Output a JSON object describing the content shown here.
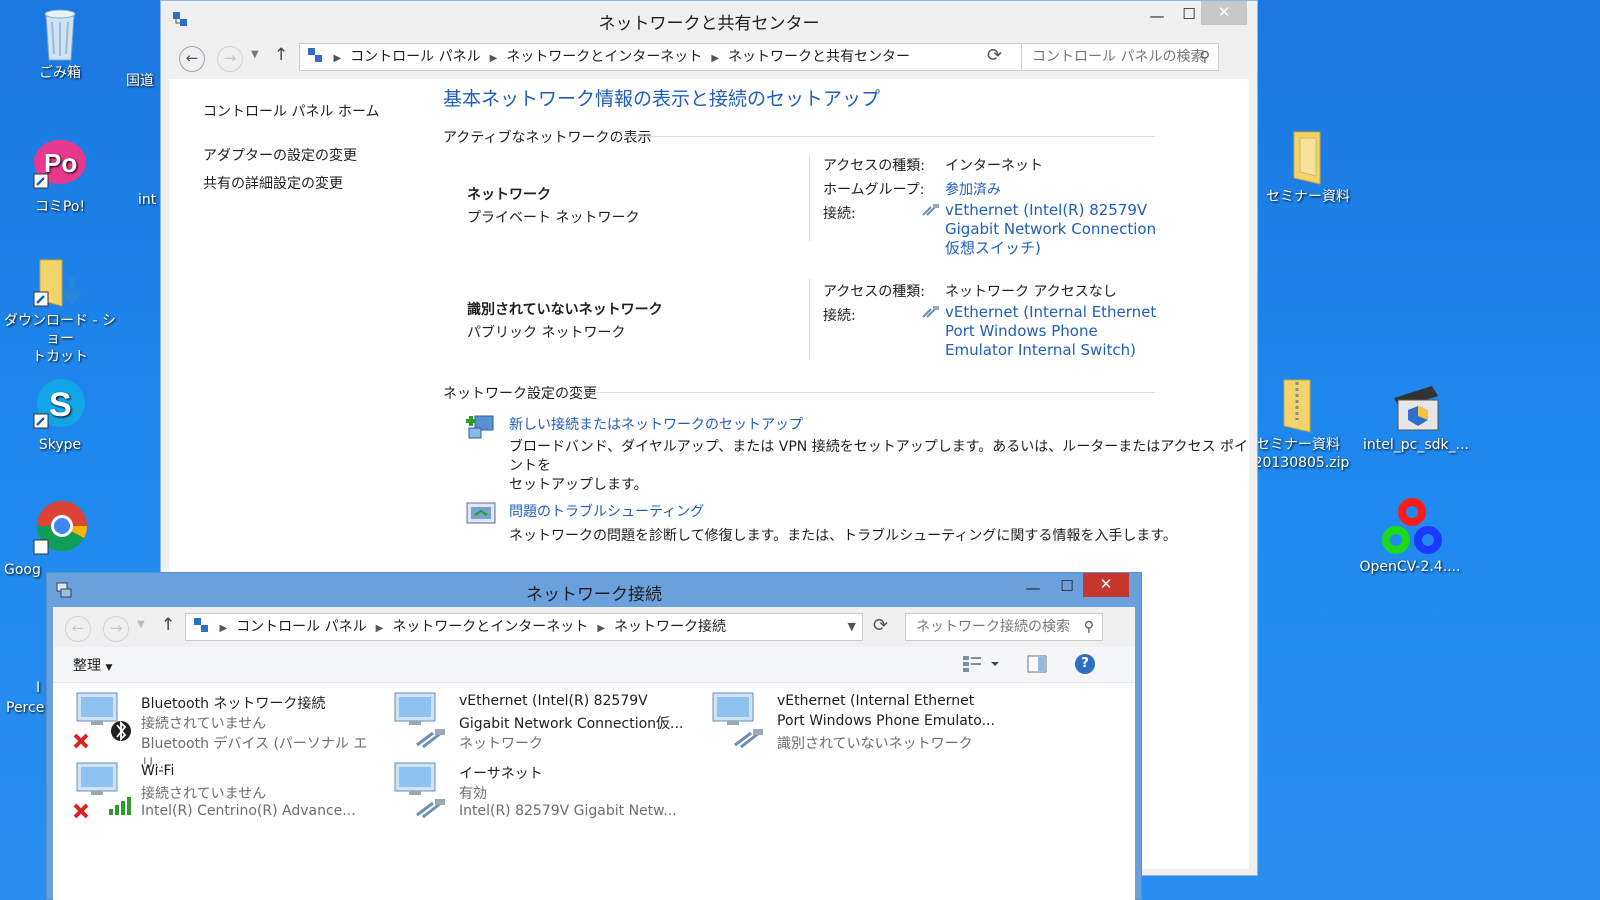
{
  "desktop": {
    "icons": [
      {
        "label": "ごみ箱"
      },
      {
        "label": "コミPo!"
      },
      {
        "label": "ダウンロード - ショートカット"
      },
      {
        "label": "Skype"
      },
      {
        "label": "Goog"
      },
      {
        "label": "セミナー資料"
      },
      {
        "label": "セミナー資料_20130805.zip"
      },
      {
        "label": "intel_pc_sdk_..."
      },
      {
        "label": "OpenCV-2.4...."
      }
    ],
    "partial": {
      "kokudo": "国道",
      "int": "int",
      "perce": "Perce",
      "i": "I"
    }
  },
  "nsc": {
    "title": "ネットワークと共有センター",
    "breadcrumbs": [
      "コントロール パネル",
      "ネットワークとインターネット",
      "ネットワークと共有センター"
    ],
    "search_placeholder": "コントロール パネルの検索",
    "sidebar": {
      "home": "コントロール パネル ホーム",
      "links": [
        "アダプターの設定の変更",
        "共有の詳細設定の変更"
      ]
    },
    "heading": "基本ネットワーク情報の表示と接続のセットアップ",
    "active_section": "アクティブなネットワークの表示",
    "networks": [
      {
        "name": "ネットワーク",
        "type": "プライベート ネットワーク",
        "access_label": "アクセスの種類:",
        "access_value": "インターネット",
        "homegroup_label": "ホームグループ:",
        "homegroup_value": "参加済み",
        "conn_label": "接続:",
        "conn_lines": [
          "vEthernet (Intel(R) 82579V",
          "Gigabit Network Connection",
          "仮想スイッチ)"
        ]
      },
      {
        "name": "識別されていないネットワーク",
        "type": "パブリック ネットワーク",
        "access_label": "アクセスの種類:",
        "access_value": "ネットワーク アクセスなし",
        "conn_label": "接続:",
        "conn_lines": [
          "vEthernet (Internal Ethernet",
          "Port Windows Phone",
          "Emulator Internal Switch)"
        ]
      }
    ],
    "change_section": "ネットワーク設定の変更",
    "tasks": [
      {
        "title": "新しい接続またはネットワークのセットアップ",
        "desc_lines": [
          "ブロードバンド、ダイヤルアップ、または VPN 接続をセットアップします。あるいは、ルーターまたはアクセス ポイントを",
          "セットアップします。"
        ]
      },
      {
        "title": "問題のトラブルシューティング",
        "desc_lines": [
          "ネットワークの問題を診断して修復します。または、トラブルシューティングに関する情報を入手します。"
        ]
      }
    ]
  },
  "nc": {
    "title": "ネットワーク接続",
    "breadcrumbs": [
      "コントロール パネル",
      "ネットワークとインターネット",
      "ネットワーク接続"
    ],
    "search_placeholder": "ネットワーク接続の検索",
    "organize": "整理",
    "help": "?",
    "adapters": [
      {
        "name": "Bluetooth ネットワーク接続",
        "status": "接続されていません",
        "device": "Bluetooth デバイス (パーソナル エリ..."
      },
      {
        "name": "vEthernet (Intel(R) 82579V",
        "name2": "Gigabit Network Connection仮...",
        "status": "ネットワーク"
      },
      {
        "name": "vEthernet (Internal Ethernet",
        "name2": "Port Windows Phone Emulato...",
        "status": "識別されていないネットワーク"
      },
      {
        "name": "Wi-Fi",
        "status": "接続されていません",
        "device": "Intel(R) Centrino(R) Advance..."
      },
      {
        "name": "イーサネット",
        "status": "有効",
        "device": "Intel(R) 82579V Gigabit Netw..."
      }
    ]
  },
  "colors": {
    "accent": "#1f5ebd",
    "close_red": "#c7372c",
    "desktop_blue": "#1f8af0"
  }
}
